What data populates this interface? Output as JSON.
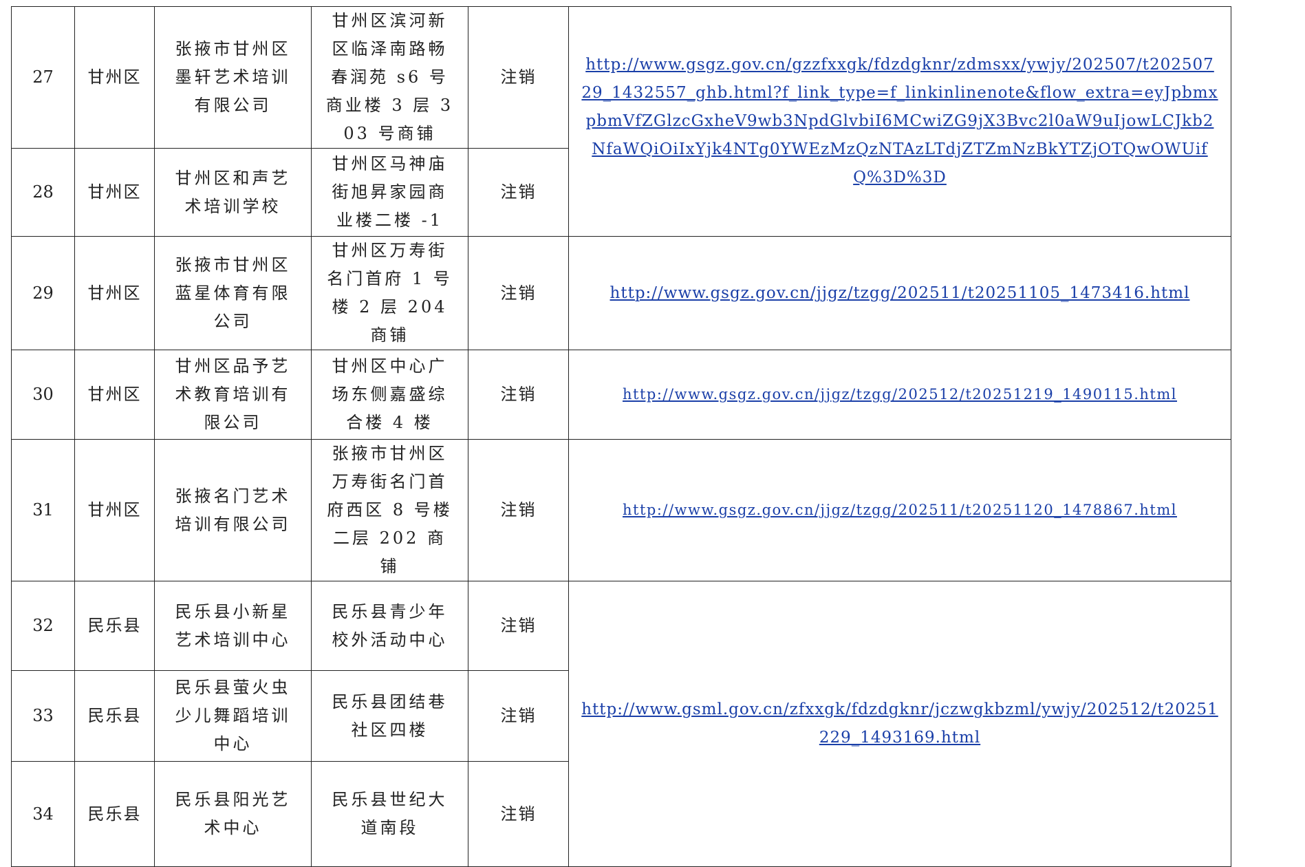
{
  "rows": [
    {
      "num": "27",
      "district": "甘州区",
      "name": "张掖市甘州区墨轩艺术培训有限公司",
      "address": "甘州区滨河新区临泽南路畅春润苑 s6 号商业楼 3 层 303 号商铺",
      "status": "注销"
    },
    {
      "num": "28",
      "district": "甘州区",
      "name": "甘州区和声艺术培训学校",
      "address": "甘州区马神庙街旭昇家园商业楼二楼 -1",
      "status": "注销"
    },
    {
      "num": "29",
      "district": "甘州区",
      "name": "张掖市甘州区蓝星体育有限公司",
      "address": "甘州区万寿街名门首府 1 号楼 2 层 204 商铺",
      "status": "注销"
    },
    {
      "num": "30",
      "district": "甘州区",
      "name": "甘州区品予艺术教育培训有限公司",
      "address": "甘州区中心广场东侧嘉盛综合楼 4 楼",
      "status": "注销"
    },
    {
      "num": "31",
      "district": "甘州区",
      "name": "张掖名门艺术培训有限公司",
      "address": "张掖市甘州区万寿街名门首府西区 8 号楼二层 202 商铺",
      "status": "注销"
    },
    {
      "num": "32",
      "district": "民乐县",
      "name": "民乐县小新星艺术培训中心",
      "address": "民乐县青少年校外活动中心",
      "status": "注销"
    },
    {
      "num": "33",
      "district": "民乐县",
      "name": "民乐县萤火虫少儿舞蹈培训中心",
      "address": "民乐县团结巷社区四楼",
      "status": "注销"
    },
    {
      "num": "34",
      "district": "民乐县",
      "name": "民乐县阳光艺术中心",
      "address": "民乐县世纪大道南段",
      "status": "注销"
    }
  ],
  "links": {
    "link_27_28": "http://www.gsgz.gov.cn/gzzfxxgk/fdzdgknr/zdmsxx/ywjy/202507/t20250729_1432557_ghb.html?f_link_type=f_linkinlinenote&flow_extra=eyJpbmxpbmVfZGlzcGxheV9wb3NpdGlvbiI6MCwiZG9jX3Bvc2l0aW9uIjowLCJkb2NfaWQiOiIxYjk4NTg0YWEzMzQzNTAzLTdjZTZmNzBkYTZjOTQwOWUifQ%3D%3D",
    "link_29": "http://www.gsgz.gov.cn/jjgz/tzgg/202511/t20251105_1473416.html",
    "link_30": "http://www.gsgz.gov.cn/jjgz/tzgg/202512/t20251219_1490115.html",
    "link_31": "http://www.gsgz.gov.cn/jjgz/tzgg/202511/t20251120_1478867.html",
    "link_32_34": "http://www.gsml.gov.cn/zfxxgk/fdzdgknr/jczwgkbzml/ywjy/202512/t20251229_1493169.html"
  }
}
